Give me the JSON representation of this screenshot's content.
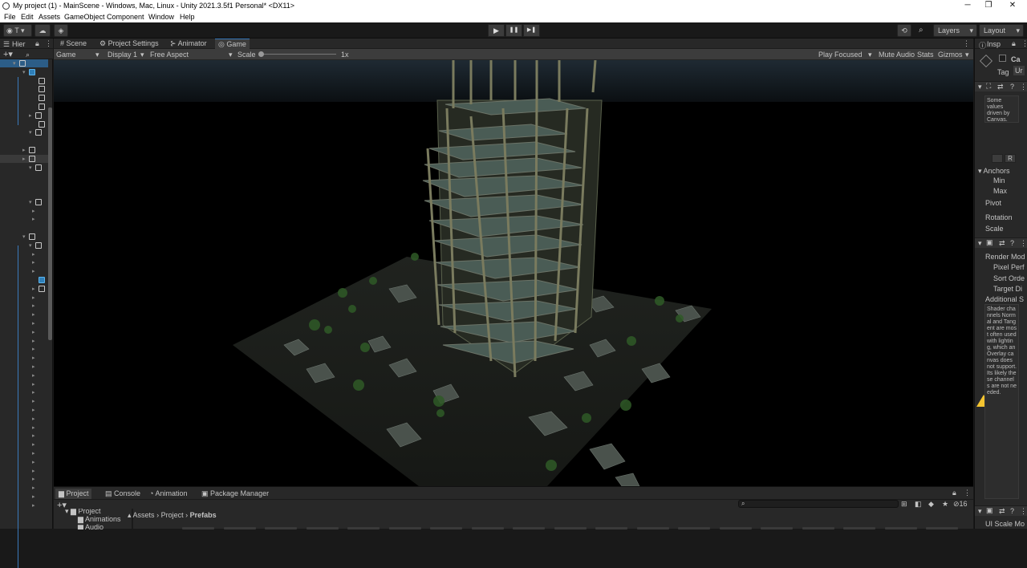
{
  "titlebar": {
    "title": "My project (1) - MainScene - Windows, Mac, Linux - Unity 2021.3.5f1 Personal* <DX11>",
    "minimize": "─",
    "restore": "❐",
    "close": "✕"
  },
  "menu": [
    "File",
    "Edit",
    "Assets",
    "GameObject",
    "Component",
    "Window",
    "Help"
  ],
  "toolbar": {
    "account": "T",
    "layers": "Layers",
    "layout": "Layout",
    "play": "▶",
    "pause": "❚❚",
    "step": "▶❚"
  },
  "hierarchy": {
    "title": "Hier"
  },
  "view_tabs": [
    {
      "label": "Scene",
      "icon": "#"
    },
    {
      "label": "Project Settings",
      "icon": "⚙"
    },
    {
      "label": "Animator",
      "icon": "⊱"
    },
    {
      "label": "Game",
      "icon": "◎"
    }
  ],
  "game_toolbar": {
    "mode": "Game",
    "display": "Display 1",
    "aspect": "Free Aspect",
    "scale_label": "Scale",
    "scale_value": "1x",
    "play_focused": "Play Focused",
    "mute": "Mute Audio",
    "stats": "Stats",
    "gizmos": "Gizmos"
  },
  "bottom": {
    "tabs": [
      {
        "label": "Project",
        "icon": "▆"
      },
      {
        "label": "Console",
        "icon": "▤"
      },
      {
        "label": "Animation",
        "icon": "◔"
      },
      {
        "label": "Package Manager",
        "icon": "▣"
      }
    ],
    "tree": [
      "Project",
      "Animations",
      "Audio"
    ],
    "breadcrumb": [
      "Assets",
      "Project",
      "Prefabs"
    ],
    "hidden_count": "16"
  },
  "inspector": {
    "title": "Insp",
    "object_name": "Ca",
    "tag_label": "Tag",
    "tag_value": "Ur",
    "driven_note": "Some values driven by Canvas.",
    "anchors": "Anchors",
    "min": "Min",
    "max": "Max",
    "pivot": "Pivot",
    "rotation": "Rotation",
    "scale": "Scale",
    "render_mode": "Render Mod",
    "pixel_perfect": "Pixel Perf",
    "sort_order": "Sort Orde",
    "target_display": "Target Di",
    "additional": "Additional S",
    "warning": "Shader channels Normal and Tangent are most often used with lighting, which an Overlay canvas does not support. Its likely these channels are not needed.",
    "ui_scale": "UI Scale Mo",
    "r_button": "R"
  },
  "colors": {
    "accent": "#3a79bb",
    "panel": "#282828",
    "header": "#3c3c3c",
    "warning": "#f4c430"
  }
}
